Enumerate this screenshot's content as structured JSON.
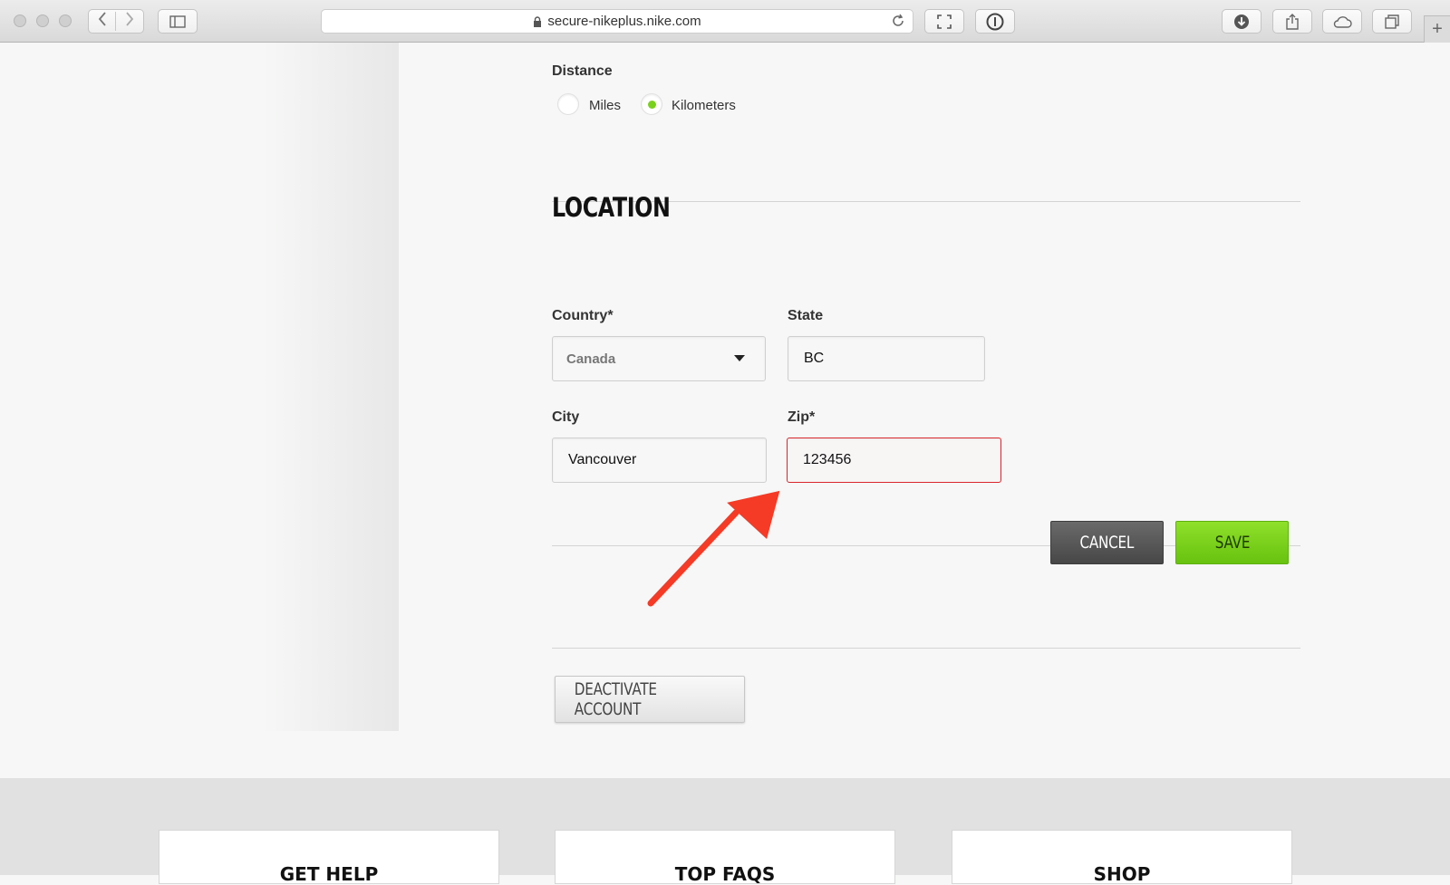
{
  "browser": {
    "url": "secure-nikeplus.nike.com",
    "plus_label": "+"
  },
  "distance": {
    "label": "Distance",
    "options": [
      {
        "label": "Miles",
        "checked": false
      },
      {
        "label": "Kilometers",
        "checked": true
      }
    ]
  },
  "location": {
    "title": "LOCATION",
    "country_label": "Country*",
    "country_value": "Canada",
    "state_label": "State",
    "state_value": "BC",
    "city_label": "City",
    "city_value": "Vancouver",
    "zip_label": "Zip*",
    "zip_value": "123456"
  },
  "actions": {
    "cancel": "CANCEL",
    "save": "SAVE",
    "deactivate": "DEACTIVATE ACCOUNT"
  },
  "footer": {
    "cards": [
      "GET HELP",
      "TOP FAQS",
      "SHOP"
    ]
  },
  "colors": {
    "accent_green": "#7ad11b",
    "error_red": "#d9262d",
    "annotation_arrow": "#f53a26"
  }
}
